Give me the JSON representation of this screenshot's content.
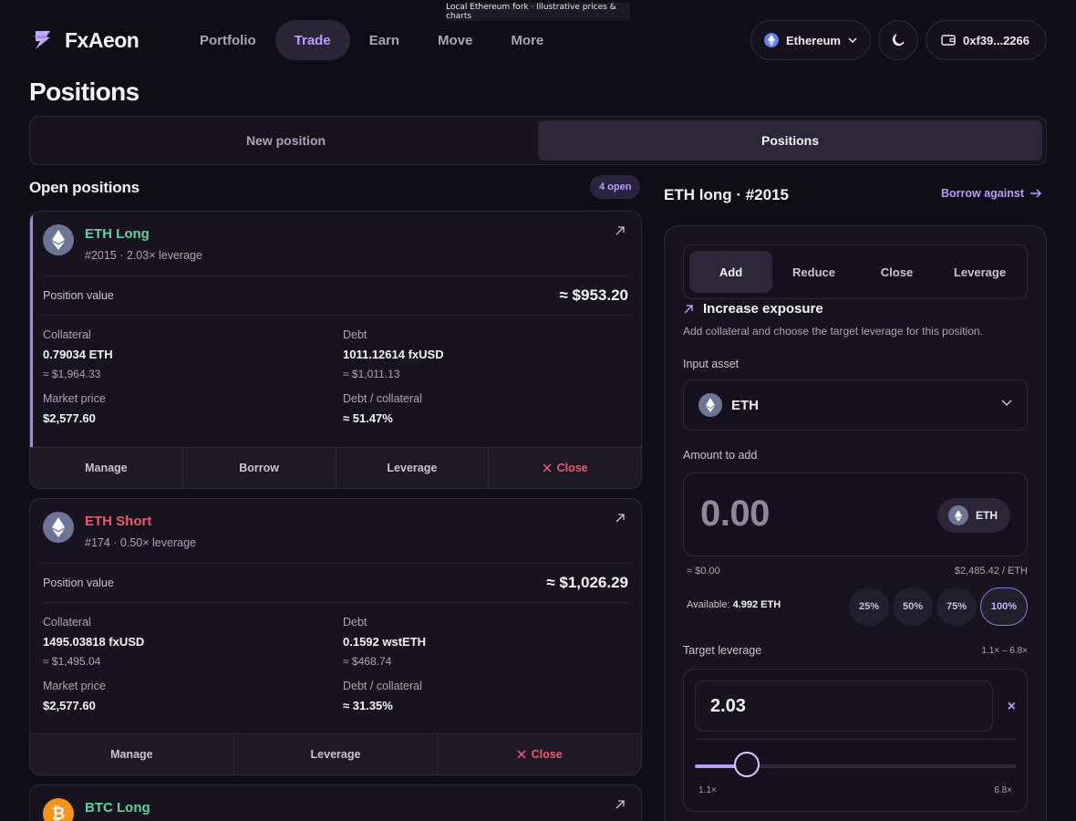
{
  "banner": "Local Ethereum fork · Illustrative prices & charts",
  "app": {
    "name": "FxAeon"
  },
  "nav": [
    {
      "label": "Portfolio",
      "active": false
    },
    {
      "label": "Trade",
      "active": true
    },
    {
      "label": "Earn",
      "active": false
    },
    {
      "label": "Move",
      "active": false
    },
    {
      "label": "More",
      "active": false
    }
  ],
  "header": {
    "network": "Ethereum",
    "wallet": "0xf39...2266"
  },
  "page_title": "Positions",
  "tabs": [
    {
      "label": "New position",
      "active": false
    },
    {
      "label": "Positions",
      "active": true
    }
  ],
  "open_positions": {
    "title": "Open positions",
    "badge": "4 open",
    "cards": [
      {
        "name": "ETH Long",
        "side": "long",
        "sub": "#2015 · 2.03× leverage",
        "position_value_label": "Position value",
        "position_value": "≈ $953.20",
        "collateral_label": "Collateral",
        "collateral": "0.79034 ETH",
        "collateral_usd": "≈ $1,964.33",
        "debt_label": "Debt",
        "debt": "1011.12614 fxUSD",
        "debt_usd": "≈ $1,011.13",
        "market_price_label": "Market price",
        "market_price": "$2,577.60",
        "ratio_label": "Debt / collateral",
        "ratio": "≈ 51.47%",
        "actions": [
          "Manage",
          "Borrow",
          "Leverage",
          "Close"
        ]
      },
      {
        "name": "ETH Short",
        "side": "short",
        "sub": "#174 · 0.50× leverage",
        "position_value_label": "Position value",
        "position_value": "≈ $1,026.29",
        "collateral_label": "Collateral",
        "collateral": "1495.03818 fxUSD",
        "collateral_usd": "≈ $1,495.04",
        "debt_label": "Debt",
        "debt": "0.1592 wstETH",
        "debt_usd": "≈ $468.74",
        "market_price_label": "Market price",
        "market_price": "$2,577.60",
        "ratio_label": "Debt / collateral",
        "ratio": "≈ 31.35%",
        "actions": [
          "Manage",
          "Leverage",
          "Close"
        ]
      },
      {
        "name": "BTC Long",
        "side": "long"
      }
    ]
  },
  "detail": {
    "title": "ETH long · #2015",
    "borrow_link": "Borrow against",
    "seg_tabs": [
      {
        "label": "Add",
        "active": true
      },
      {
        "label": "Reduce",
        "active": false
      },
      {
        "label": "Close",
        "active": false
      },
      {
        "label": "Leverage",
        "active": false
      }
    ],
    "heading": "Increase exposure",
    "description": "Add collateral and choose the target leverage for this position.",
    "input_asset_label": "Input asset",
    "input_asset": "ETH",
    "amount_label": "Amount to add",
    "amount_value": "0.00",
    "amount_token": "ETH",
    "amount_usd": "≈ $0.00",
    "price": "$2,485.42 / ETH",
    "available_label": "Available:",
    "available_value": "4.992 ETH",
    "percents": [
      {
        "label": "25%",
        "active": false
      },
      {
        "label": "50%",
        "active": false
      },
      {
        "label": "75%",
        "active": false
      },
      {
        "label": "100%",
        "active": true
      }
    ],
    "target_leverage_label": "Target leverage",
    "leverage_range": "1.1× – 6.8×",
    "leverage_value": "2.03",
    "slider_min": "1.1×",
    "slider_max": "6.8×",
    "slider_fraction": 0.163,
    "clear_icon": "×"
  },
  "colors": {
    "accent": "#b79cff",
    "long": "#5fd39c",
    "short": "#f0596d"
  }
}
